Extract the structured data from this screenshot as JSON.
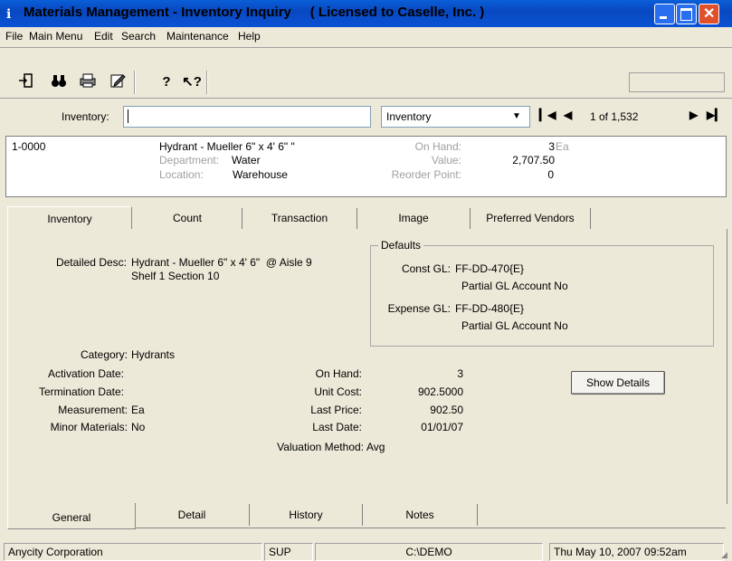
{
  "window": {
    "title": "Materials Management - Inventory Inquiry",
    "license": "( Licensed to Caselle, Inc. )"
  },
  "menu": [
    "File",
    "Main Menu",
    "Edit",
    "Search",
    "Maintenance",
    "Help"
  ],
  "toolbar": {
    "icons": [
      "exit-icon",
      "binoculars-icon",
      "printer-icon",
      "edit-note-icon",
      "help-icon",
      "context-help-icon"
    ]
  },
  "inventory_row": {
    "label": "Inventory:",
    "input_value": "",
    "select_value": "Inventory",
    "record_position": "1 of 1,532"
  },
  "summary": {
    "item_number": "1-0000",
    "description": "Hydrant - Mueller 6\" x 4' 6\" \"",
    "department_label": "Department:",
    "department": "Water",
    "location_label": "Location:",
    "location": "Warehouse",
    "on_hand_label": "On Hand:",
    "on_hand": "3",
    "on_hand_unit": "Ea",
    "value_label": "Value:",
    "value": "2,707.50",
    "reorder_label": "Reorder Point:",
    "reorder": "0"
  },
  "tabs": [
    "Inventory",
    "Count",
    "Transaction",
    "Image",
    "Preferred Vendors"
  ],
  "general": {
    "detailed_desc_label": "Detailed Desc:",
    "detailed_desc_1": "Hydrant - Mueller 6\" x 4' 6\"  @ Aisle 9",
    "detailed_desc_2": "Shelf 1 Section 10",
    "defaults_title": "Defaults",
    "const_gl_label": "Const GL:",
    "const_gl": "FF-DD-470{E}",
    "const_gl_note": "Partial GL Account No",
    "expense_gl_label": "Expense GL:",
    "expense_gl": "FF-DD-480{E}",
    "expense_gl_note": "Partial GL Account No",
    "category_label": "Category:",
    "category": "Hydrants",
    "activation_label": "Activation Date:",
    "activation": "",
    "termination_label": "Termination Date:",
    "termination": "",
    "measurement_label": "Measurement:",
    "measurement": "Ea",
    "minor_label": "Minor Materials:",
    "minor": "No",
    "on_hand_label": "On Hand:",
    "on_hand": "3",
    "unit_cost_label": "Unit Cost:",
    "unit_cost": "902.5000",
    "last_price_label": "Last Price:",
    "last_price": "902.50",
    "last_date_label": "Last Date:",
    "last_date": "01/01/07",
    "valuation_label": "Valuation Method:",
    "valuation": "Avg",
    "show_details": "Show Details"
  },
  "bottom_tabs": [
    "General",
    "Detail",
    "History",
    "Notes"
  ],
  "status": {
    "company": "Anycity Corporation",
    "user": "SUP",
    "path": "C:\\DEMO",
    "datetime": "Thu May 10, 2007  09:52am"
  }
}
